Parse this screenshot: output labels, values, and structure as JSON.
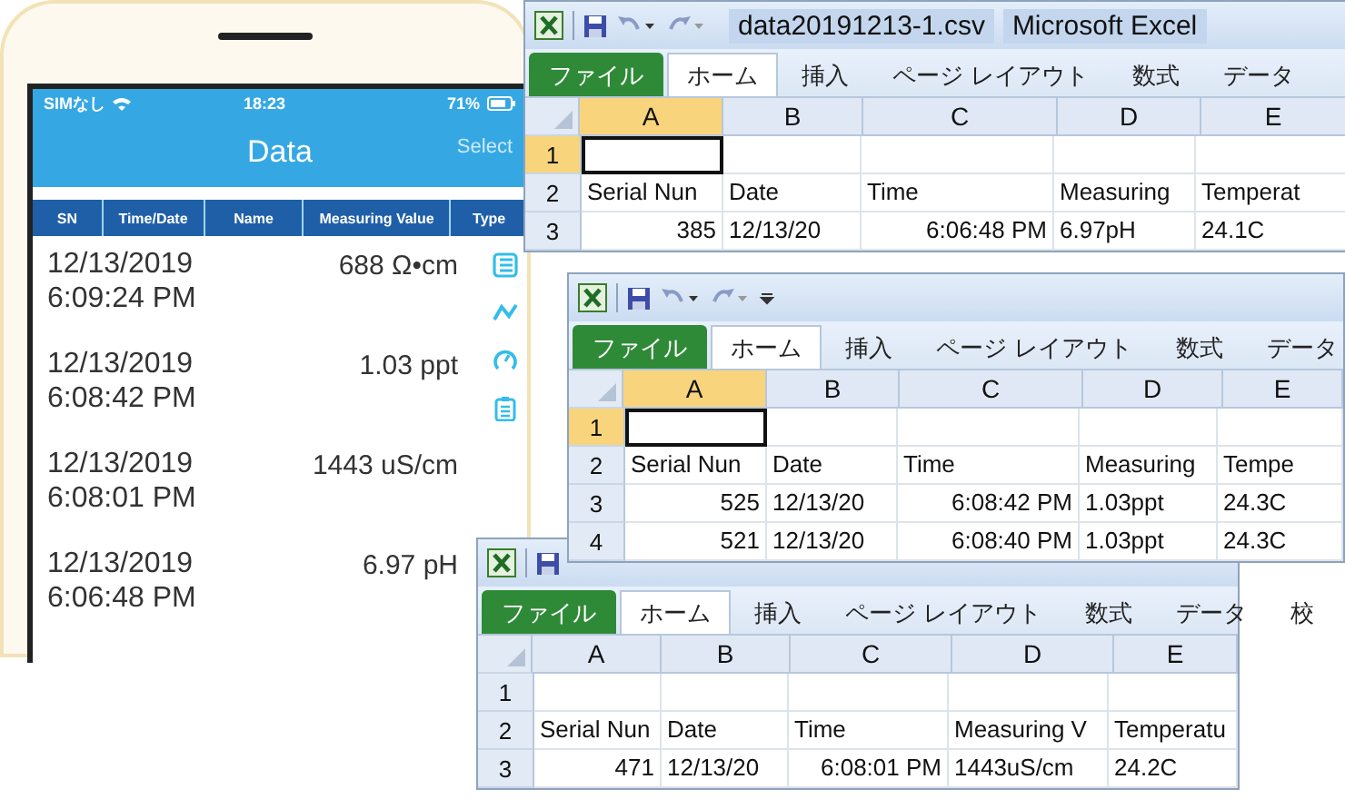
{
  "phone": {
    "status_bar": {
      "carrier": "SIMなし",
      "time": "18:23",
      "battery": "71%"
    },
    "title": "Data",
    "action": "Select",
    "columns": [
      "SN",
      "Time/Date",
      "Name",
      "Measuring Value",
      "Type"
    ],
    "rows": [
      {
        "date": "12/13/2019",
        "time": "6:09:24 PM",
        "value": "688 Ω•cm"
      },
      {
        "date": "12/13/2019",
        "time": "6:08:42 PM",
        "value": "1.03 ppt"
      },
      {
        "date": "12/13/2019",
        "time": "6:08:01 PM",
        "value": "1443 uS/cm"
      },
      {
        "date": "12/13/2019",
        "time": "6:06:48 PM",
        "value": "6.97 pH"
      }
    ]
  },
  "excel_windows": [
    {
      "title": {
        "file": "data20191213-1.csv",
        "app": "Microsoft Excel"
      },
      "tabs": [
        {
          "label": "ファイル",
          "kind": "file",
          "selected": false
        },
        {
          "label": "ホーム",
          "kind": "tab",
          "selected": true
        },
        {
          "label": "挿入",
          "kind": "tab",
          "selected": false
        },
        {
          "label": "ページ レイアウト",
          "kind": "tab",
          "selected": false
        },
        {
          "label": "数式",
          "kind": "tab",
          "selected": false
        },
        {
          "label": "データ",
          "kind": "tab",
          "selected": false
        }
      ],
      "columns": [
        {
          "label": "A",
          "selected": true,
          "numeric": true
        },
        {
          "label": "B",
          "selected": false,
          "numeric": false
        },
        {
          "label": "C",
          "selected": false,
          "numeric": true
        },
        {
          "label": "D",
          "selected": false,
          "numeric": false
        },
        {
          "label": "E",
          "selected": false,
          "numeric": false
        }
      ],
      "rows": [
        {
          "label": "1",
          "selected": true,
          "cells": []
        },
        {
          "label": "2",
          "selected": false,
          "kind": "header",
          "cells": [
            "Serial Nun",
            "Date",
            "Time",
            "Measuring",
            "Temperat"
          ]
        },
        {
          "label": "3",
          "selected": false,
          "kind": "record",
          "cells": [
            "385",
            "12/13/20",
            "6:06:48 PM",
            "6.97pH",
            "24.1C"
          ]
        }
      ]
    },
    {
      "tabs": [
        {
          "label": "ファイル",
          "kind": "file",
          "selected": false
        },
        {
          "label": "ホーム",
          "kind": "tab",
          "selected": true
        },
        {
          "label": "挿入",
          "kind": "tab",
          "selected": false
        },
        {
          "label": "ページ レイアウト",
          "kind": "tab",
          "selected": false
        },
        {
          "label": "数式",
          "kind": "tab",
          "selected": false
        },
        {
          "label": "データ",
          "kind": "tab",
          "selected": false
        }
      ],
      "columns": [
        {
          "label": "A",
          "selected": true,
          "numeric": true
        },
        {
          "label": "B",
          "selected": false,
          "numeric": false
        },
        {
          "label": "C",
          "selected": false,
          "numeric": true
        },
        {
          "label": "D",
          "selected": false,
          "numeric": false
        },
        {
          "label": "E",
          "selected": false,
          "numeric": false
        }
      ],
      "rows": [
        {
          "label": "1",
          "selected": true,
          "cells": []
        },
        {
          "label": "2",
          "selected": false,
          "kind": "header",
          "cells": [
            "Serial Nun",
            "Date",
            "Time",
            "Measuring",
            "Tempe"
          ]
        },
        {
          "label": "3",
          "selected": false,
          "kind": "record",
          "cells": [
            "525",
            "12/13/20",
            "6:08:42 PM",
            "1.03ppt",
            "24.3C"
          ]
        },
        {
          "label": "4",
          "selected": false,
          "kind": "record",
          "cells": [
            "521",
            "12/13/20",
            "6:08:40 PM",
            "1.03ppt",
            "24.3C"
          ]
        }
      ]
    },
    {
      "tabs": [
        {
          "label": "ファイル",
          "kind": "file",
          "selected": false
        },
        {
          "label": "ホーム",
          "kind": "tab",
          "selected": true
        },
        {
          "label": "挿入",
          "kind": "tab",
          "selected": false
        },
        {
          "label": "ページ レイアウト",
          "kind": "tab",
          "selected": false
        },
        {
          "label": "数式",
          "kind": "tab",
          "selected": false
        },
        {
          "label": "データ",
          "kind": "tab",
          "selected": false
        },
        {
          "label": "校",
          "kind": "tab",
          "selected": false
        }
      ],
      "columns": [
        {
          "label": "A",
          "selected": false,
          "numeric": true
        },
        {
          "label": "B",
          "selected": false,
          "numeric": false
        },
        {
          "label": "C",
          "selected": false,
          "numeric": true
        },
        {
          "label": "D",
          "selected": false,
          "numeric": false
        },
        {
          "label": "E",
          "selected": false,
          "numeric": false
        }
      ],
      "rows": [
        {
          "label": "1",
          "selected": false,
          "cells": []
        },
        {
          "label": "2",
          "selected": false,
          "kind": "header",
          "cells": [
            "Serial Nun",
            "Date",
            "Time",
            "Measuring V",
            "Temperatu"
          ]
        },
        {
          "label": "3",
          "selected": false,
          "kind": "record",
          "cells": [
            "471",
            "12/13/20",
            "6:08:01 PM",
            "1443uS/cm",
            "24.2C"
          ]
        }
      ]
    }
  ]
}
